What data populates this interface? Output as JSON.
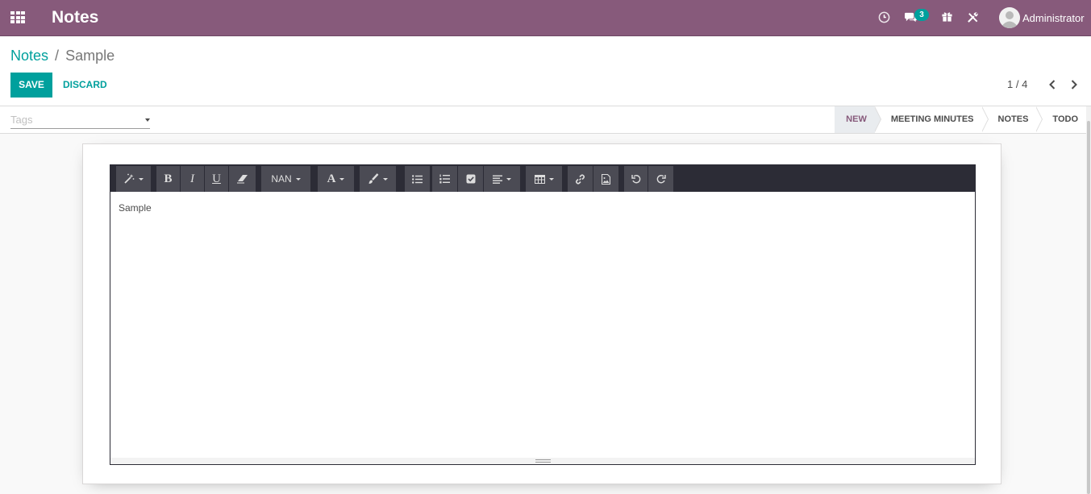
{
  "navbar": {
    "app_title": "Notes",
    "messages_count": "3",
    "user_name": "Administrator",
    "brand_color": "#875a7b",
    "icons": [
      "apps-icon",
      "activity-clock-icon",
      "chat-icon",
      "gift-icon",
      "debug-tools-icon",
      "avatar"
    ]
  },
  "breadcrumb": {
    "parent": "Notes",
    "separator": "/",
    "current": "Sample"
  },
  "actions": {
    "save_label": "SAVE",
    "discard_label": "DISCARD"
  },
  "pager": {
    "value": "1 / 4"
  },
  "tags": {
    "placeholder": "Tags"
  },
  "stages": {
    "items": [
      "NEW",
      "MEETING MINUTES",
      "NOTES",
      "TODO"
    ],
    "active": "NEW"
  },
  "editor": {
    "toolbar": {
      "font_size_label": "NAN",
      "buttons": [
        "style-magic",
        "bold",
        "italic",
        "underline",
        "eraser",
        "font-size",
        "font-color",
        "background-color",
        "unordered-list",
        "ordered-list",
        "checklist",
        "paragraph-align",
        "table",
        "link",
        "image",
        "undo",
        "redo"
      ]
    },
    "content": "Sample"
  },
  "colors": {
    "accent": "#00a09d",
    "toolbar_bg": "#2c2c36",
    "toolbar_button": "#4b4b54"
  }
}
